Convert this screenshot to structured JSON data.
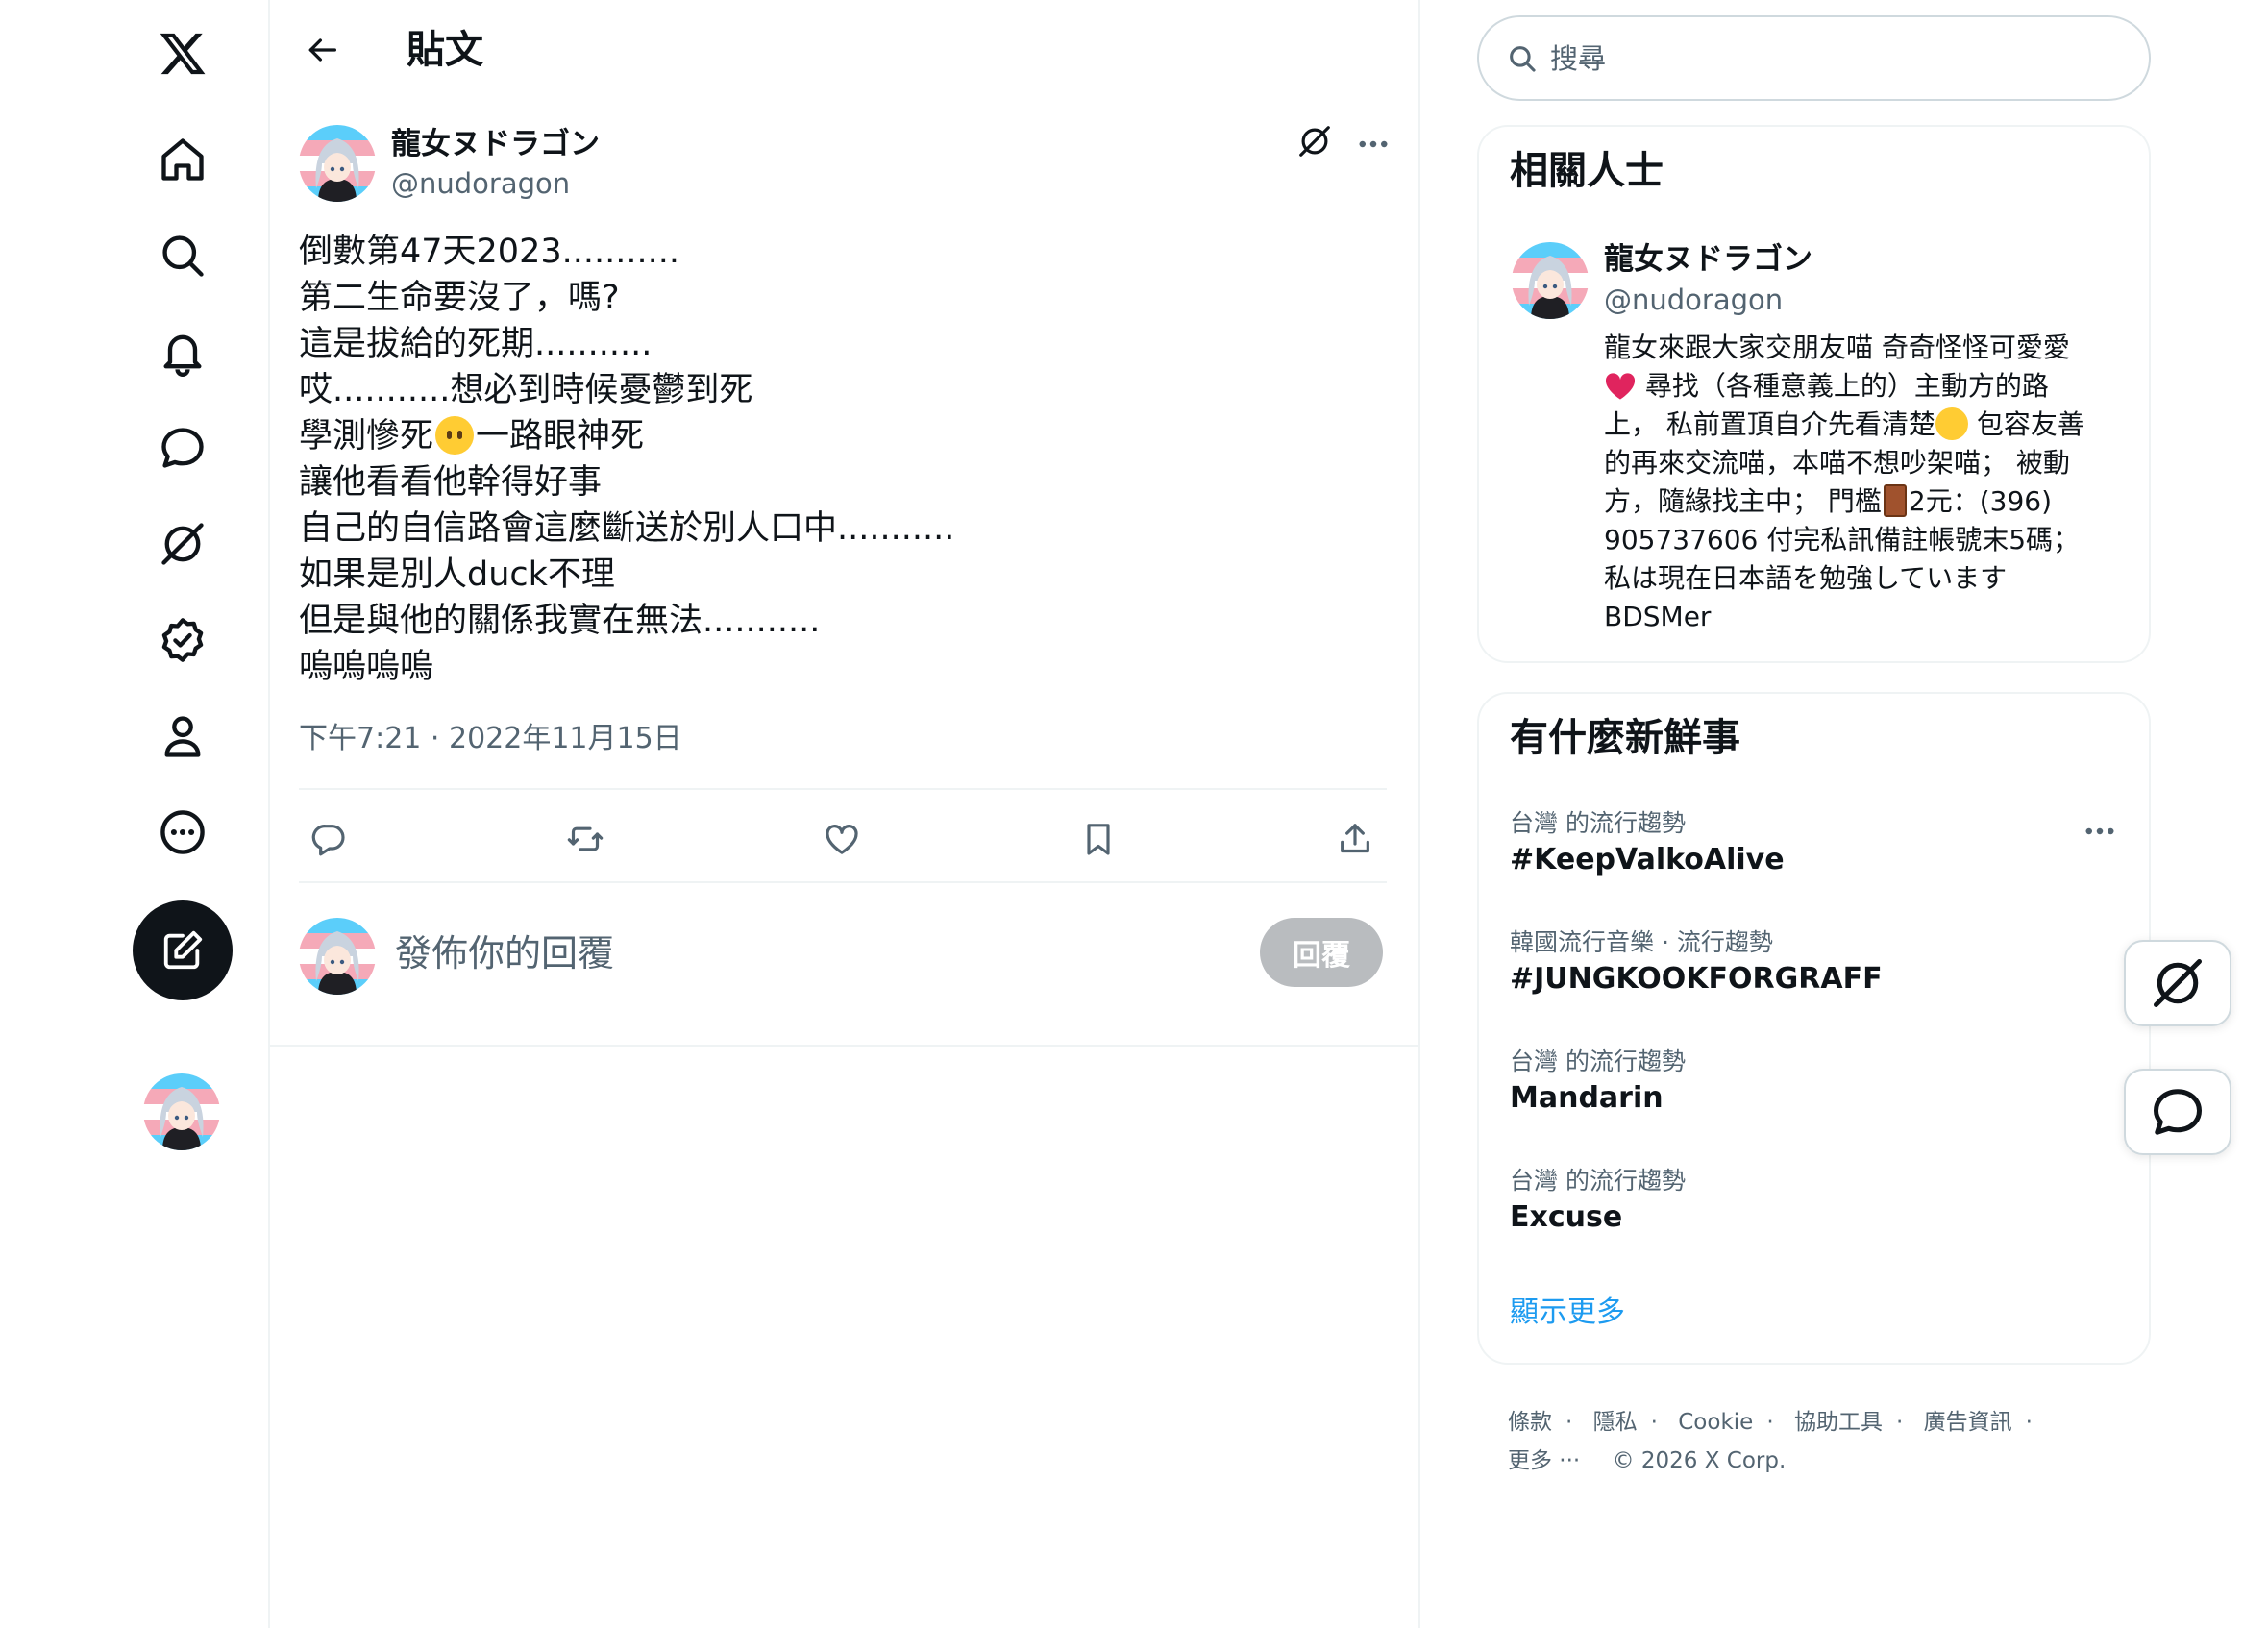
{
  "page": {
    "title": "貼文"
  },
  "post": {
    "author_name": "龍女ヌドラゴン",
    "author_handle": "@nudoragon",
    "lines": [
      "倒數第47天2023...........",
      "第二生命要沒了，嗎?",
      "這是拔給的死期...........",
      "哎...........想必到時候憂鬱到死",
      "學測慘死",
      "一路眼神死",
      "讓他看看他幹得好事",
      "自己的自信路會這麼斷送於別人口中...........",
      "如果是別人duck不理",
      "但是與他的關係我實在無法...........",
      "嗚嗚嗚嗚"
    ],
    "timestamp": "下午7:21 · 2022年11月15日"
  },
  "reply": {
    "placeholder": "發佈你的回覆",
    "button_label": "回覆"
  },
  "search": {
    "placeholder": "搜尋"
  },
  "relevant": {
    "title": "相關人士",
    "name": "龍女ヌドラゴン",
    "handle": "@nudoragon",
    "bio": [
      "龍女來跟大家交朋友喵 奇奇怪怪可愛愛",
      "尋找（各種意義上的）主動方的路",
      "上， 私前置頂自介先看清楚",
      "包容友善",
      "的再來交流喵，本喵不想吵架喵； 被動",
      "方，隨緣找主中； 門檻",
      "2元：(396)",
      "905737606 付完私訊備註帳號末5碼；",
      "私は現在日本語を勉強しています",
      "BDSMer"
    ]
  },
  "trends": {
    "title": "有什麼新鮮事",
    "items": [
      {
        "meta": "台灣 的流行趨勢",
        "name": "#KeepValkoAlive"
      },
      {
        "meta": "韓國流行音樂 · 流行趨勢",
        "name": "#JUNGKOOKFORGRAFF"
      },
      {
        "meta": "台灣 的流行趨勢",
        "name": "Mandarin"
      },
      {
        "meta": "台灣 的流行趨勢",
        "name": "Excuse"
      }
    ],
    "show_more": "顯示更多"
  },
  "footer": {
    "links": [
      "條款",
      "隱私",
      "Cookie",
      "協助工具",
      "廣告資訊",
      "更多 ···"
    ],
    "copyright": "© 2026 X Corp."
  },
  "colors": {
    "accent": "#1d9bf0",
    "text": "#0f1419",
    "muted": "#536471",
    "border": "#eff3f4"
  },
  "icons": {
    "nav": [
      "x-logo-icon",
      "home-icon",
      "search-icon",
      "notifications-icon",
      "messages-icon",
      "grok-icon",
      "verified-icon",
      "profile-icon",
      "more-icon"
    ],
    "actions": [
      "reply-icon",
      "repost-icon",
      "like-icon",
      "bookmark-icon",
      "share-icon"
    ]
  }
}
